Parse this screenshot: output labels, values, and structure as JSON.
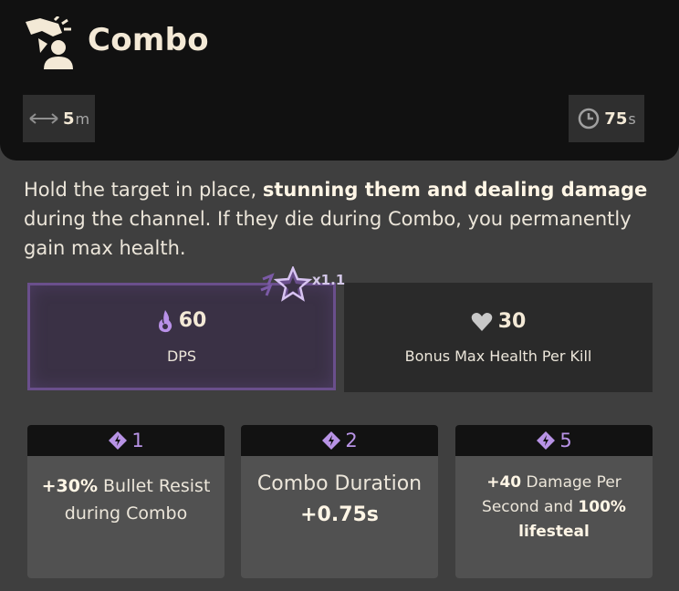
{
  "ability": {
    "title": "Combo",
    "icon": "hand-grab-icon",
    "range_value": "5",
    "range_unit": "m",
    "cooldown_value": "75",
    "cooldown_unit": "s"
  },
  "description": {
    "part1": "Hold the target in place, ",
    "bold1": "stunning them and dealing damage",
    "part2": " during the channel. If they die during Combo, you permanently gain max health."
  },
  "properties": [
    {
      "value": "60",
      "label": "DPS",
      "icon": "spirit-flame-icon"
    },
    {
      "value": "30",
      "label": "Bonus Max Health Per Kill",
      "icon": "heart-icon"
    }
  ],
  "spirit_scaling": {
    "multiplier": "x1.1",
    "icon": "spirit-star-icon"
  },
  "upgrades": [
    {
      "tier": "1",
      "bold_a": "+30%",
      "text_a": " Bullet Resist during Combo"
    },
    {
      "tier": "2",
      "text_a": "Combo Duration",
      "bold_a": "+0.75s"
    },
    {
      "tier": "5",
      "bold_a": "+40",
      "text_a": " Damage Per Second and ",
      "bold_b": "100%",
      "text_b": " lifesteal"
    }
  ],
  "colors": {
    "accent_purple": "#b893e6",
    "header_bg": "#111111",
    "panel_bg": "#3f3f3f"
  }
}
